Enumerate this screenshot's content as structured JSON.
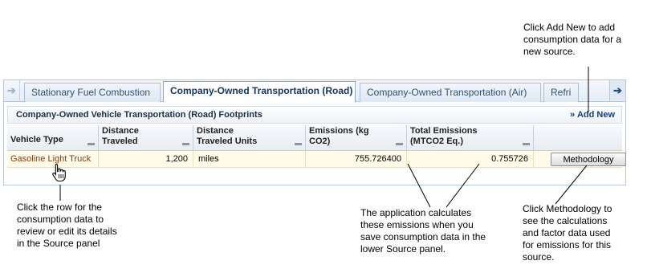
{
  "callouts": {
    "add_new": [
      "Click Add New to add",
      "consumption data for a",
      "new source."
    ],
    "row": [
      "Click the row for the",
      "consumption data to",
      "review or edit its details",
      "in the Source panel"
    ],
    "emissions": [
      "The application calculates",
      "these emissions when you",
      "save consumption data in the",
      "lower Source panel."
    ],
    "methodology": [
      "Click Methodology to",
      "see the calculations",
      "and factor data used",
      "for emissions for this",
      "source."
    ]
  },
  "tabs": [
    {
      "label": "Stationary Fuel Combustion",
      "active": false
    },
    {
      "label": "Company-Owned Transportation (Road)",
      "active": true
    },
    {
      "label": "Company-Owned Transportation (Air)",
      "active": false
    },
    {
      "label": "Refri",
      "active": false
    }
  ],
  "icons": {
    "scroll_left": "arrow-left-icon",
    "scroll_right": "arrow-right-icon",
    "cursor": "hand-pointer-icon"
  },
  "panel": {
    "title": "Company-Owned Vehicle Transportation (Road) Footprints",
    "add_new_label": "» Add New"
  },
  "grid": {
    "columns": [
      {
        "label_line1": "Vehicle Type",
        "label_line2": ""
      },
      {
        "label_line1": "Distance",
        "label_line2": "Traveled"
      },
      {
        "label_line1": "Distance",
        "label_line2": "Traveled Units"
      },
      {
        "label_line1": "Emissions (kg",
        "label_line2": "CO2)"
      },
      {
        "label_line1": "Total Emissions",
        "label_line2": "(MTCO2 Eq.)"
      }
    ],
    "rows": [
      {
        "vehicle_type": "Gasoline Light Truck",
        "distance_traveled": "1,200",
        "distance_units": "miles",
        "emissions_kg": "755.726400",
        "total_emissions": "0.755726",
        "action_label": "Methodology"
      }
    ]
  },
  "colors": {
    "tab_text": "#2f4f77",
    "link": "#8a3a0f",
    "row_highlight": "#fffbe8",
    "add_new": "#173e78"
  }
}
